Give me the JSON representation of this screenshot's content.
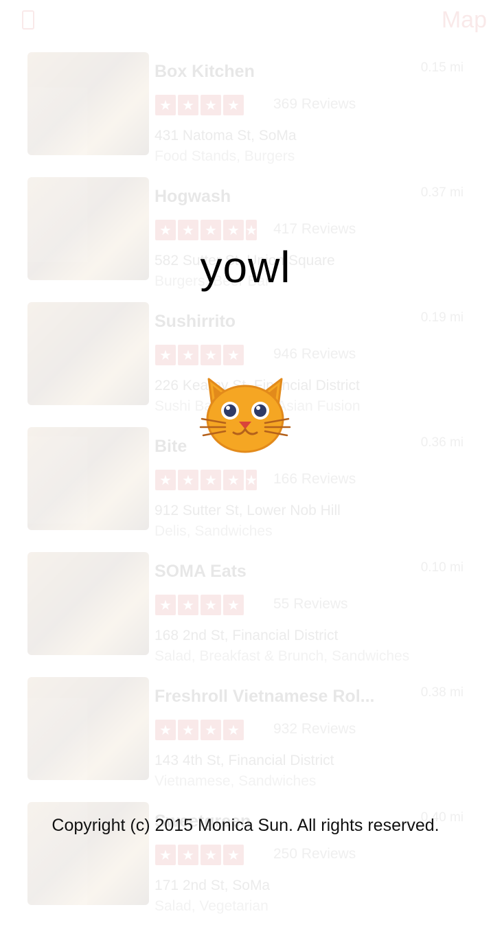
{
  "app": {
    "name": "yowl"
  },
  "topbar": {
    "map_label": "Map"
  },
  "businesses": [
    {
      "name": "Box Kitchen",
      "distance": "0.15 mi",
      "rating": 4.0,
      "reviews": "369 Reviews",
      "address": "431 Natoma St, SoMa",
      "categories": "Food Stands, Burgers"
    },
    {
      "name": "Hogwash",
      "distance": "0.37 mi",
      "rating": 4.5,
      "reviews": "417 Reviews",
      "address": "582 Sutter St, Union Square",
      "categories": "Burgers, Beer Bar"
    },
    {
      "name": "Sushirrito",
      "distance": "0.19 mi",
      "rating": 4.0,
      "reviews": "946 Reviews",
      "address": "226 Kearny St, Financial District",
      "categories": "Sushi Bars, Tacos, Asian Fusion"
    },
    {
      "name": "Bite",
      "distance": "0.36 mi",
      "rating": 4.5,
      "reviews": "166 Reviews",
      "address": "912 Sutter St, Lower Nob Hill",
      "categories": "Delis, Sandwiches"
    },
    {
      "name": "SOMA Eats",
      "distance": "0.10 mi",
      "rating": 4.0,
      "reviews": "55 Reviews",
      "address": "168 2nd St, Financial District",
      "categories": "Salad, Breakfast & Brunch, Sandwiches"
    },
    {
      "name": "Freshroll Vietnamese Rol...",
      "distance": "0.38 mi",
      "rating": 4.0,
      "reviews": "932 Reviews",
      "address": "143 4th St, Financial District",
      "categories": "Vietnamese, Sandwiches"
    },
    {
      "name": "Sweetgreen",
      "distance": "0.40 mi",
      "rating": 4.0,
      "reviews": "250 Reviews",
      "address": "171 2nd St, SoMa",
      "categories": "Salad, Vegetarian"
    }
  ],
  "splash": {
    "title": "yowl",
    "copyright": "Copyright (c) 2015 Monica Sun. All rights reserved."
  },
  "colors": {
    "accent": "#c4161c",
    "cat_orange": "#f5a623",
    "cat_outline": "#e28a1b"
  },
  "icons": {
    "logo": "cat-face-icon",
    "filter": "filter-icon",
    "star": "star-icon"
  }
}
